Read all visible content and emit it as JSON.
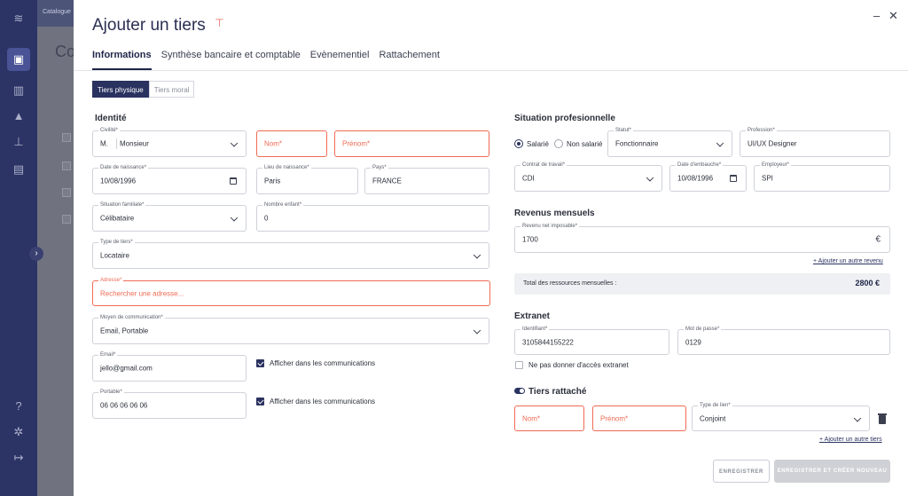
{
  "background": {
    "topbar_label": "Catalogue",
    "page_title": "Co",
    "sidebar_icons": [
      "menu-logo-icon",
      "tiers-icon",
      "building-icon",
      "chart-icon",
      "pin-icon",
      "document-alert-icon",
      "help-icon",
      "settings-icon",
      "logout-icon"
    ]
  },
  "modal": {
    "title": "Ajouter un tiers",
    "minimize_glyph": "–",
    "close_glyph": "✕",
    "tabs": [
      "Informations",
      "Synthèse bancaire et comptable",
      "Evènementiel",
      "Rattachement"
    ],
    "segment": {
      "options": [
        "Tiers physique",
        "Tiers moral"
      ],
      "selected": "Tiers physique"
    }
  },
  "identite": {
    "title": "Identité",
    "civilite": {
      "label": "Civilité*",
      "short": "M.",
      "value": "Monsieur"
    },
    "nom": {
      "placeholder": "Nom*"
    },
    "prenom": {
      "placeholder": "Prénom*"
    },
    "date_naissance": {
      "label": "Date de naissance*",
      "value": "10/08/1996"
    },
    "lieu_naissance": {
      "label": "Lieu de naissance*",
      "value": "Paris"
    },
    "pays": {
      "label": "Pays*",
      "value": "FRANCE"
    },
    "situation_familiale": {
      "label": "Situation familiale*",
      "value": "Célibataire"
    },
    "nombre_enfant": {
      "label": "Nombre enfant*",
      "value": "0"
    },
    "type_tiers": {
      "label": "Type de tiers*",
      "value": "Locataire"
    },
    "adresse": {
      "label": "Adresse*",
      "placeholder": "Rechercher une adresse..."
    },
    "moyen_communication": {
      "label": "Moyen de communication*",
      "value": "Email, Portable"
    },
    "email": {
      "label": "Email*",
      "value": "jello@gmail.com",
      "checkbox": "Afficher dans les communications"
    },
    "portable": {
      "label": "Portable*",
      "value": "06 06 06 06 06",
      "checkbox": "Afficher dans les communications"
    }
  },
  "situation": {
    "title": "Situation profesionnelle",
    "radio_salarie": "Salarié",
    "radio_non_salarie": "Non salarié",
    "statut": {
      "label": "Statut*",
      "value": "Fonctionnaire"
    },
    "profession": {
      "label": "Profession*",
      "value": "UI/UX Designer"
    },
    "contrat": {
      "label": "Contrat de travail*",
      "value": "CDI"
    },
    "date_embauche": {
      "label": "Date d'embauche*",
      "value": "10/08/1996"
    },
    "employeur": {
      "label": "Employeur*",
      "value": "SPI"
    }
  },
  "revenus": {
    "title": "Revenus mensuels",
    "net_imposable": {
      "label": "Revenu net imposable*",
      "value": "1700",
      "currency": "€"
    },
    "add_link": "+ Ajouter un autre revenu",
    "total_label": "Total des ressources mensuelles :",
    "total_value": "2800 €"
  },
  "extranet": {
    "title": "Extranet",
    "identifiant": {
      "label": "Identifiant*",
      "value": "3105844155222"
    },
    "mot_de_passe": {
      "label": "Mot de passe*",
      "value": "0129"
    },
    "checkbox": "Ne pas donner d'accès extranet"
  },
  "tiers_rattache": {
    "title": "Tiers rattaché",
    "nom": {
      "placeholder": "Nom*"
    },
    "prenom": {
      "placeholder": "Prénom*"
    },
    "type_lien": {
      "label": "Type de lien*",
      "value": "Conjoint"
    },
    "add_link": "+ Ajouter un autre tiers"
  },
  "actions": {
    "save": "ENREGISTRER",
    "save_new": "ENREGISTRER ET CRÉER NOUVEAU"
  },
  "colors": {
    "primary": "#2a3260",
    "error": "#ef6b55",
    "sidebar": "#2c3466"
  }
}
